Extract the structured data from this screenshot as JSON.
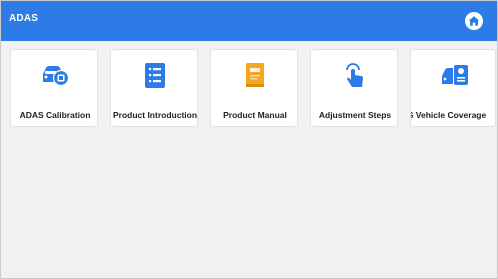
{
  "window": {
    "title": "ADAS"
  },
  "header": {
    "home_icon": "home-icon"
  },
  "tiles": [
    {
      "label": "ADAS Calibration",
      "icon": "car-camera-icon"
    },
    {
      "label": "Product Introduction",
      "icon": "list-document-icon"
    },
    {
      "label": "Product Manual",
      "icon": "manual-book-icon"
    },
    {
      "label": "Adjustment Steps",
      "icon": "touch-hand-icon"
    },
    {
      "label": "S Vehicle Coverage",
      "icon": "vehicle-coverage-icon"
    }
  ],
  "colors": {
    "header_bg": "#2d7be6",
    "icon_blue": "#2d7be6",
    "icon_orange": "#f5a623",
    "background": "#f1f1f1"
  }
}
